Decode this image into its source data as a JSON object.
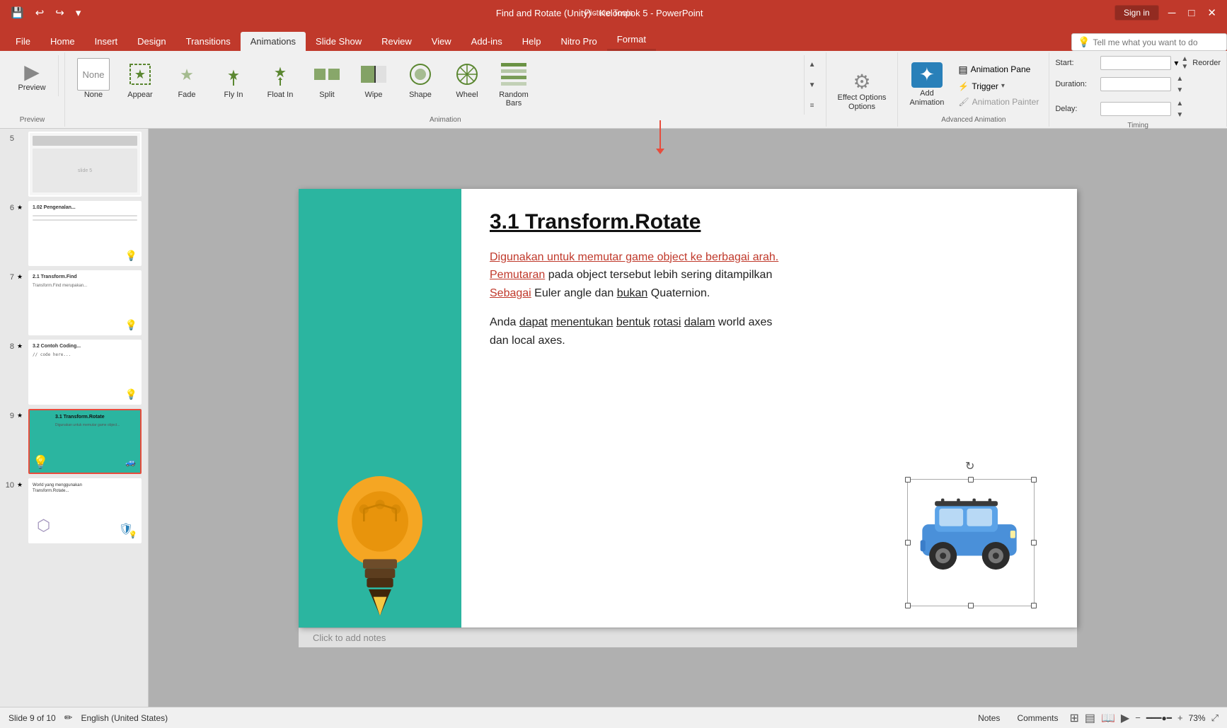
{
  "titlebar": {
    "title": "Find and Rotate (Unity) - Kelompok 5 - PowerPoint",
    "picture_tools": "Picture Tools",
    "signin": "Sign in"
  },
  "tabs": [
    {
      "label": "File",
      "active": false
    },
    {
      "label": "Home",
      "active": false
    },
    {
      "label": "Insert",
      "active": false
    },
    {
      "label": "Design",
      "active": false
    },
    {
      "label": "Transitions",
      "active": false
    },
    {
      "label": "Animations",
      "active": true
    },
    {
      "label": "Slide Show",
      "active": false
    },
    {
      "label": "Review",
      "active": false
    },
    {
      "label": "View",
      "active": false
    },
    {
      "label": "Add-ins",
      "active": false
    },
    {
      "label": "Help",
      "active": false
    },
    {
      "label": "Nitro Pro",
      "active": false
    },
    {
      "label": "Format",
      "active": false
    }
  ],
  "ribbon": {
    "preview_label": "Preview",
    "animation_group_label": "Animation",
    "advanced_animation_label": "Advanced Animation",
    "timing_label": "Timing",
    "animations": [
      {
        "id": "none",
        "label": "None",
        "selected": false
      },
      {
        "id": "appear",
        "label": "Appear",
        "selected": false
      },
      {
        "id": "fade",
        "label": "Fade",
        "selected": false
      },
      {
        "id": "fly-in",
        "label": "Fly In",
        "selected": false
      },
      {
        "id": "float-in",
        "label": "Float In",
        "selected": false
      },
      {
        "id": "split",
        "label": "Split",
        "selected": false
      },
      {
        "id": "wipe",
        "label": "Wipe",
        "selected": false
      },
      {
        "id": "shape",
        "label": "Shape",
        "selected": false
      },
      {
        "id": "wheel",
        "label": "Wheel",
        "selected": false
      },
      {
        "id": "random-bars",
        "label": "Random Bars",
        "selected": false
      }
    ],
    "add_animation_label": "Add\nAnimation",
    "animation_pane_label": "Animation Pane",
    "trigger_label": "Trigger",
    "animation_painter_label": "Animation Painter",
    "effect_options_label": "Effect Options",
    "timing": {
      "start_label": "Start:",
      "duration_label": "Duration:",
      "delay_label": "Delay:",
      "reorder_label": "Reorder"
    }
  },
  "slide_panel": {
    "slides": [
      {
        "num": "5",
        "has_star": false
      },
      {
        "num": "6",
        "has_star": true
      },
      {
        "num": "7",
        "has_star": true
      },
      {
        "num": "8",
        "has_star": true
      },
      {
        "num": "9",
        "has_star": true,
        "selected": true
      },
      {
        "num": "10",
        "has_star": true
      }
    ]
  },
  "slide": {
    "title": "3.1 Transform.Rotate",
    "body1_red": "Digunakan untuk memutar game object ke berbagai arah.",
    "body1_part2_red": "Pemutaran",
    "body1_part2_rest": " pada object tersebut lebih sering ditampilkan",
    "body1_part3_red": "Sebagai",
    "body1_part3_rest": " Euler angle dan ",
    "body1_bukan": "bukan",
    "body1_end": " Quaternion.",
    "body2": "Anda dapat menentukan bentuk rotasi dalam world axes dan local axes."
  },
  "statusbar": {
    "slide_info": "Slide 9 of 10",
    "language": "English (United States)",
    "notes_label": "Notes",
    "comments_label": "Comments",
    "zoom_level": "73%"
  },
  "notes_area": {
    "placeholder": "Click to add notes"
  },
  "tellme": {
    "placeholder": "Tell me what you want to do"
  }
}
